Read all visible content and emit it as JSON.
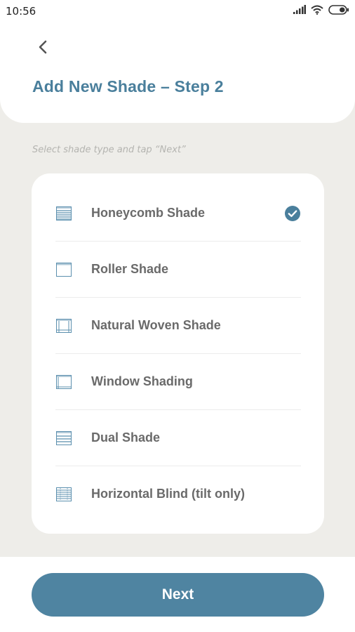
{
  "status_bar": {
    "time": "10:56",
    "icons": [
      "signal-icon",
      "wifi-icon",
      "battery-icon"
    ]
  },
  "header": {
    "title": "Add New Shade – Step 2",
    "back_icon": "chevron-left-icon"
  },
  "instruction": "Select shade type and tap “Next”",
  "shade_types": [
    {
      "label": "Honeycomb Shade",
      "icon": "honeycomb-shade-icon",
      "selected": true
    },
    {
      "label": "Roller Shade",
      "icon": "roller-shade-icon",
      "selected": false
    },
    {
      "label": "Natural Woven Shade",
      "icon": "natural-woven-shade-icon",
      "selected": false
    },
    {
      "label": "Window Shading",
      "icon": "window-shading-icon",
      "selected": false
    },
    {
      "label": "Dual Shade",
      "icon": "dual-shade-icon",
      "selected": false
    },
    {
      "label": "Horizontal Blind (tilt only)",
      "icon": "horizontal-blind-icon",
      "selected": false
    }
  ],
  "footer": {
    "next_label": "Next"
  },
  "colors": {
    "accent": "#4a7f9c",
    "button": "#4f84a1",
    "background": "#eeede9",
    "label": "#6a6a6a"
  }
}
